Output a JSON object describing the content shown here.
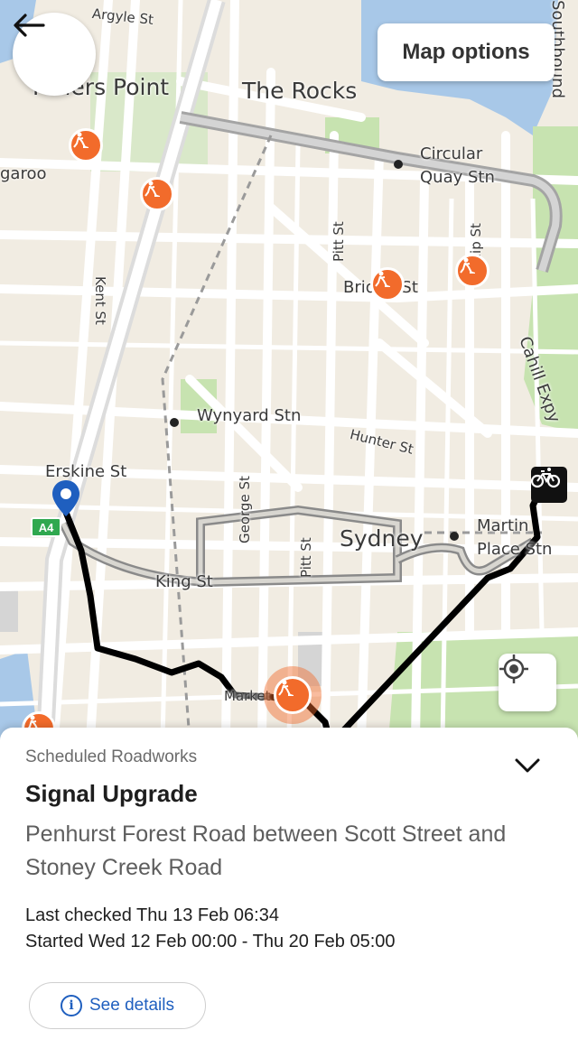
{
  "header": {
    "back_icon": "arrow-left-icon",
    "map_options_label": "Map options"
  },
  "map": {
    "labels": {
      "argyle": "Argyle St",
      "millers_point": "Millers Point",
      "the_rocks": "The Rocks",
      "garoo": "garoo",
      "circular_quay_1": "Circular",
      "circular_quay_2": "Quay Stn",
      "kent": "Kent St",
      "pitt_top": "Pitt St",
      "bridge": "Bridge St",
      "phillip": "Phillip St",
      "cahill": "Cahill Expy",
      "southbound": "Southbound",
      "wynyard": "Wynyard Stn",
      "hunter": "Hunter St",
      "erskine": "Erskine St",
      "george": "George St",
      "pitt_bottom": "Pitt St",
      "sydney": "Sydney",
      "martin_1": "Martin",
      "martin_2": "Place Stn",
      "king": "King St",
      "market": "Market St",
      "a4": "A4"
    },
    "icons": {
      "roadworks": "roadworks-icon",
      "bike": "bicycle-icon",
      "pin": "location-pin-icon",
      "locate": "my-location-icon"
    },
    "colors": {
      "roadworks": "#f26b2b",
      "route": "#000000",
      "water": "#a8c8e8",
      "park": "#c7e3b0",
      "pin": "#1f5fbf"
    }
  },
  "sheet": {
    "category": "Scheduled Roadworks",
    "title": "Signal Upgrade",
    "location": "Penhurst Forest Road between Scott Street and Stoney Creek Road",
    "last_checked": "Last checked Thu 13 Feb 06:34",
    "duration": "Started Wed 12 Feb 00:00 - Thu 20 Feb 05:00",
    "details_label": "See details",
    "collapse_icon": "chevron-down-icon",
    "info_icon": "info-icon"
  }
}
